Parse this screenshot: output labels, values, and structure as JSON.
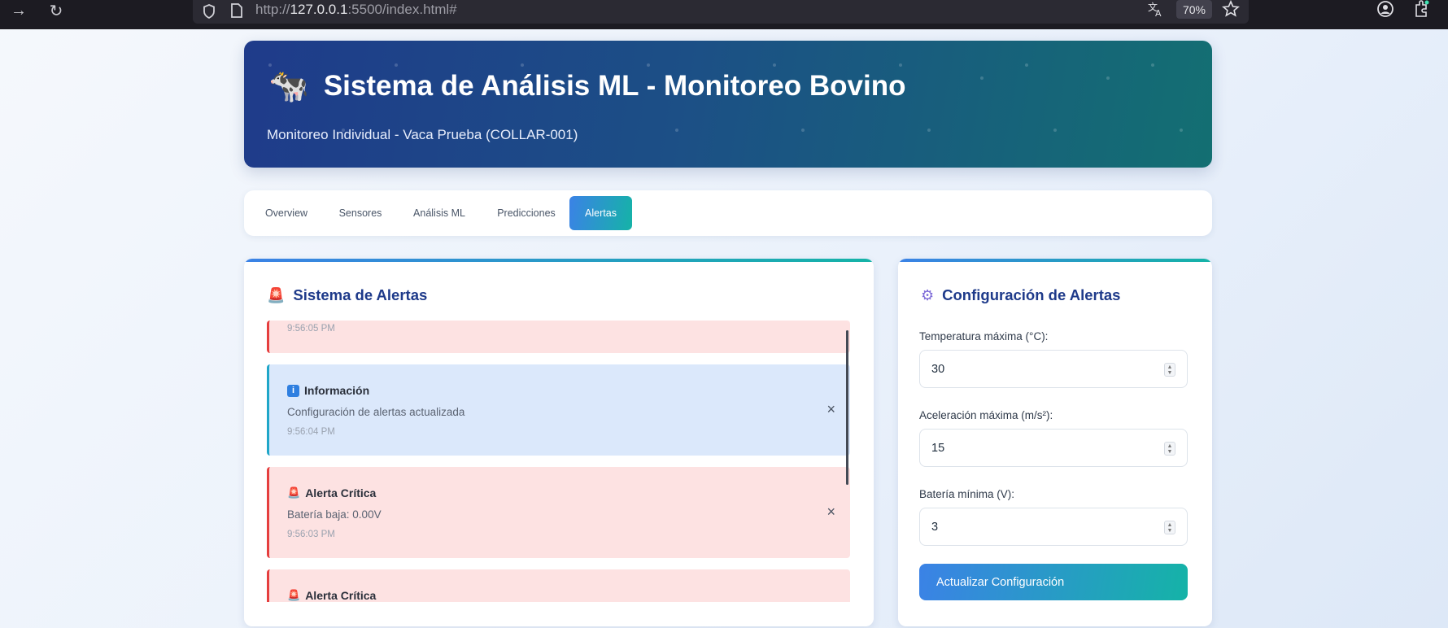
{
  "browser": {
    "url_prefix": "http://",
    "url_host": "127.0.0.1",
    "url_rest": ":5500/index.html#",
    "zoom": "70%"
  },
  "header": {
    "title": "Sistema de Análisis ML - Monitoreo Bovino",
    "subtitle": "Monitoreo Individual - Vaca Prueba (COLLAR-001)",
    "icon": "cow-icon"
  },
  "tabs": [
    {
      "label": "Overview",
      "active": false
    },
    {
      "label": "Sensores",
      "active": false
    },
    {
      "label": "Análisis ML",
      "active": false
    },
    {
      "label": "Predicciones",
      "active": false
    },
    {
      "label": "Alertas",
      "active": true
    }
  ],
  "alerts_panel": {
    "title": "Sistema de Alertas",
    "icon": "siren-icon",
    "alerts": [
      {
        "type": "critical",
        "title": "",
        "message": "",
        "time": "9:56:05 PM"
      },
      {
        "type": "info",
        "title": "Información",
        "message": "Configuración de alertas actualizada",
        "time": "9:56:04 PM",
        "icon": "info-icon"
      },
      {
        "type": "critical",
        "title": "Alerta Crítica",
        "message": "Batería baja: 0.00V",
        "time": "9:56:03 PM",
        "icon": "siren-icon"
      },
      {
        "type": "critical",
        "title": "Alerta Crítica",
        "message": "",
        "time": "",
        "icon": "siren-icon"
      }
    ],
    "close_symbol": "×"
  },
  "config_panel": {
    "title": "Configuración de Alertas",
    "icon": "gear-icon",
    "fields": [
      {
        "label": "Temperatura máxima (°C):",
        "value": "30"
      },
      {
        "label": "Aceleración máxima (m/s²):",
        "value": "15"
      },
      {
        "label": "Batería mínima (V):",
        "value": "3"
      }
    ],
    "button_label": "Actualizar Configuración"
  },
  "colors": {
    "header_start": "#1f3b8a",
    "header_end": "#136f72",
    "accent_blue": "#3b82e6",
    "accent_teal": "#15b3a7",
    "critical_bg": "#fde2e2",
    "critical_border": "#e53e3e",
    "info_bg": "#dbe8fb",
    "info_border": "#1fa6c8"
  }
}
